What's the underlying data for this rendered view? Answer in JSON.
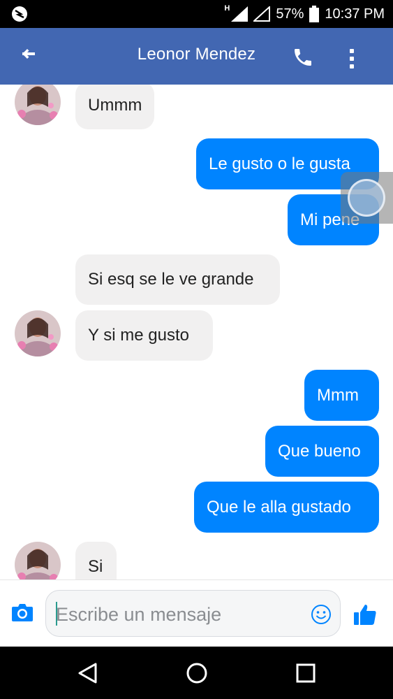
{
  "status_bar": {
    "network_label": "H",
    "battery_percent": "57%",
    "time": "10:37 PM",
    "icons": [
      "app-notification-icon",
      "signal-icon",
      "signal-empty-icon",
      "battery-icon"
    ]
  },
  "header": {
    "contact_name": "Leonor Mendez",
    "icons": {
      "back": "arrow-left-icon",
      "call": "phone-icon",
      "more": "more-vertical-icon"
    }
  },
  "messages": [
    {
      "from": "them",
      "text": "Ummm"
    },
    {
      "from": "me",
      "text": "Le gusto o le gusta"
    },
    {
      "from": "me",
      "text": "Mi pene"
    },
    {
      "from": "them",
      "text": "Si esq se le ve grande"
    },
    {
      "from": "them",
      "text": "Y si me gusto"
    },
    {
      "from": "me",
      "text": "Mmm"
    },
    {
      "from": "me",
      "text": "Que bueno"
    },
    {
      "from": "me",
      "text": "Que le alla gustado"
    },
    {
      "from": "them",
      "text": "Si"
    }
  ],
  "composer": {
    "placeholder": "Escribe un mensaje",
    "icons": {
      "camera": "camera-icon",
      "emoji": "emoji-icon",
      "like": "thumbs-up-icon"
    }
  },
  "nav_bar": {
    "icons": [
      "nav-back-icon",
      "nav-home-icon",
      "nav-recents-icon"
    ]
  },
  "colors": {
    "header_bg": "#4267b2",
    "outgoing_bubble": "#0084ff",
    "incoming_bubble": "#f1f0f0",
    "accent": "#0084ff"
  }
}
